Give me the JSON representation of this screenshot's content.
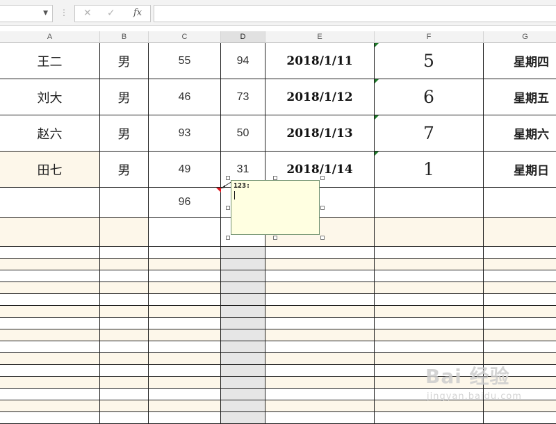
{
  "formula_bar": {
    "name_box_value": "",
    "cancel_icon": "✕",
    "confirm_icon": "✓",
    "fx_label": "fx",
    "formula_value": ""
  },
  "columns": [
    "A",
    "B",
    "C",
    "D",
    "E",
    "F",
    "G"
  ],
  "selected_column": "D",
  "rows": [
    {
      "A": "王二",
      "B": "男",
      "C": "55",
      "D": "94",
      "E": "2018/1/11",
      "F": "5",
      "G": "星期四"
    },
    {
      "A": "刘大",
      "B": "男",
      "C": "46",
      "D": "73",
      "E": "2018/1/12",
      "F": "6",
      "G": "星期五"
    },
    {
      "A": "赵六",
      "B": "男",
      "C": "93",
      "D": "50",
      "E": "2018/1/13",
      "F": "7",
      "G": "星期六"
    },
    {
      "A": "田七",
      "B": "男",
      "C": "49",
      "D": "31",
      "E": "2018/1/14",
      "F": "1",
      "G": "星期日"
    }
  ],
  "total_row": {
    "C": "96"
  },
  "comment": {
    "author": "123:",
    "text": ""
  },
  "watermark": {
    "logo_text": "Bai 经验",
    "url_text": "jingyan.baidu.com"
  }
}
